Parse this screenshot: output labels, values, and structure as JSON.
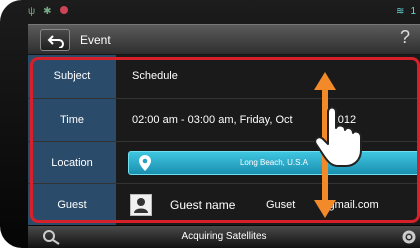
{
  "header": {
    "title": "Event"
  },
  "rows": [
    {
      "label": "Subject",
      "value": "Schedule"
    },
    {
      "label": "Time",
      "value": "02:00 am - 03:00 am, Friday, Oct",
      "value_tail": "2012"
    },
    {
      "label": "Location",
      "value": "Long Beach, U.S.A"
    },
    {
      "label": "Guest",
      "name": "Guest name",
      "email": "Guset",
      "email_tail": "@gmail.com"
    }
  ],
  "footer": {
    "status": "Acquiring Satellites"
  },
  "colors": {
    "label_bg": "#2a4b6a",
    "location_button": "#2fb5d3",
    "highlight": "#d6202a",
    "arrow": "#f28a2a"
  },
  "icons": [
    "back-icon",
    "help-icon",
    "location-pin-icon",
    "contact-icon",
    "navigation-icon",
    "settings-icon"
  ]
}
